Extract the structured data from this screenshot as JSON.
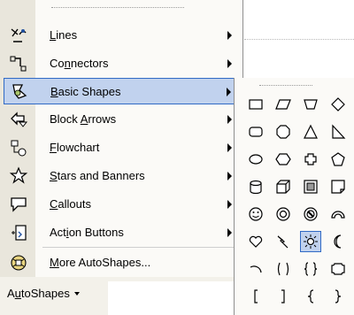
{
  "menu": {
    "items": [
      {
        "label_pre": "",
        "label_key": "L",
        "label_post": "ines",
        "icon": "lines-icon",
        "submenu": true
      },
      {
        "label_pre": "Co",
        "label_key": "n",
        "label_post": "nectors",
        "icon": "connectors-icon",
        "submenu": true
      },
      {
        "label_pre": "",
        "label_key": "B",
        "label_post": "asic Shapes",
        "icon": "basic-shapes-icon",
        "submenu": true,
        "selected": true
      },
      {
        "label_pre": "Block ",
        "label_key": "A",
        "label_post": "rrows",
        "icon": "block-arrows-icon",
        "submenu": true
      },
      {
        "label_pre": "",
        "label_key": "F",
        "label_post": "lowchart",
        "icon": "flowchart-icon",
        "submenu": true
      },
      {
        "label_pre": "",
        "label_key": "S",
        "label_post": "tars and Banners",
        "icon": "stars-banners-icon",
        "submenu": true
      },
      {
        "label_pre": "",
        "label_key": "C",
        "label_post": "allouts",
        "icon": "callouts-icon",
        "submenu": true
      },
      {
        "label_pre": "Act",
        "label_key": "i",
        "label_post": "on Buttons",
        "icon": "action-buttons-icon",
        "submenu": true
      },
      {
        "label_pre": "",
        "label_key": "M",
        "label_post": "ore AutoShapes...",
        "icon": "more-autoshapes-icon",
        "submenu": false
      }
    ]
  },
  "toolbar": {
    "autoshapes_pre": "A",
    "autoshapes_key": "u",
    "autoshapes_post": "toShapes"
  },
  "palette": {
    "selected": "sun",
    "shapes": [
      "rectangle",
      "parallelogram",
      "trapezoid",
      "diamond",
      "rounded-rectangle",
      "octagon",
      "isosceles-triangle",
      "right-triangle",
      "oval",
      "hexagon",
      "cross",
      "pentagon",
      "can",
      "cube",
      "bevel",
      "folded-corner",
      "smiley-face",
      "donut",
      "no-symbol",
      "block-arc",
      "heart",
      "lightning-bolt",
      "sun",
      "moon",
      "arc",
      "double-bracket",
      "double-brace",
      "plaque",
      "left-bracket",
      "right-bracket",
      "left-brace",
      "right-brace"
    ]
  },
  "colors": {
    "highlight": "#c1d2ee",
    "highlight_border": "#316ac5",
    "gutter": "#e9e6dc"
  }
}
